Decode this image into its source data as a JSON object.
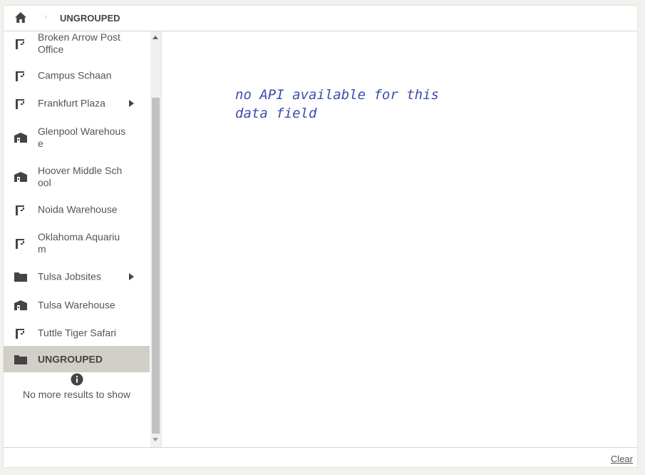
{
  "header": {
    "breadcrumb_separator": "›",
    "current": "UNGROUPED"
  },
  "sidebar": {
    "items": [
      {
        "label": "Broken Arrow Post Office",
        "icon": "crane-icon",
        "has_children": false,
        "selected": false
      },
      {
        "label": "Campus Schaan",
        "icon": "crane-icon",
        "has_children": false,
        "selected": false
      },
      {
        "label": "Frankfurt Plaza",
        "icon": "crane-icon",
        "has_children": true,
        "selected": false
      },
      {
        "label": "Glenpool Warehouse",
        "icon": "warehouse-icon",
        "has_children": false,
        "selected": false
      },
      {
        "label": "Hoover Middle School",
        "icon": "warehouse-icon",
        "has_children": false,
        "selected": false
      },
      {
        "label": "Noida Warehouse",
        "icon": "crane-icon",
        "has_children": false,
        "selected": false
      },
      {
        "label": "Oklahoma Aquarium",
        "icon": "crane-icon",
        "has_children": false,
        "selected": false
      },
      {
        "label": "Tulsa Jobsites",
        "icon": "folder-icon",
        "has_children": true,
        "selected": false
      },
      {
        "label": "Tulsa Warehouse",
        "icon": "warehouse-icon",
        "has_children": false,
        "selected": false
      },
      {
        "label": "Tuttle Tiger Safari",
        "icon": "crane-icon",
        "has_children": false,
        "selected": false
      },
      {
        "label": "UNGROUPED",
        "icon": "folder-icon",
        "has_children": false,
        "selected": true
      }
    ],
    "no_more_text": "No more results to show"
  },
  "main": {
    "note": "no API available for this data field"
  },
  "footer": {
    "clear_label": "Clear"
  },
  "colors": {
    "selected_bg": "#d2cfc9",
    "note_text": "#3a4db0",
    "icon": "#444444"
  }
}
